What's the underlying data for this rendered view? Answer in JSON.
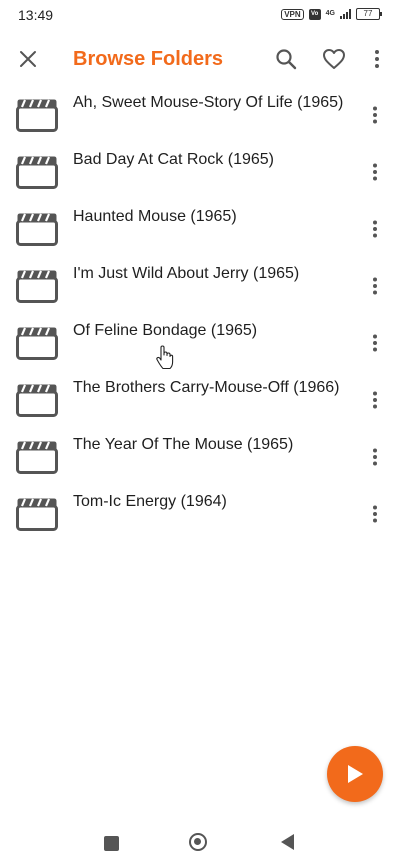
{
  "status_bar": {
    "time": "13:49",
    "vpn": "VPN",
    "volte": "VoLTE",
    "network": "4G",
    "battery": "77"
  },
  "app_bar": {
    "title": "Browse Folders",
    "close_icon": "close-icon",
    "search_icon": "search-icon",
    "favorite_icon": "heart-icon",
    "more_icon": "more-vertical-icon"
  },
  "folders": [
    {
      "label": "Ah, Sweet Mouse-Story Of Life (1965)"
    },
    {
      "label": "Bad Day At Cat Rock (1965)"
    },
    {
      "label": "Haunted Mouse (1965)"
    },
    {
      "label": "I'm Just Wild About Jerry (1965)"
    },
    {
      "label": "Of Feline Bondage (1965)"
    },
    {
      "label": "The Brothers Carry-Mouse-Off (1966)"
    },
    {
      "label": "The Year Of The Mouse (1965)"
    },
    {
      "label": "Tom-Ic Energy (1964)"
    }
  ],
  "colors": {
    "accent": "#f26a1b",
    "icon": "#555555",
    "text": "#1f1f1f"
  },
  "fab": {
    "icon": "play-icon"
  }
}
